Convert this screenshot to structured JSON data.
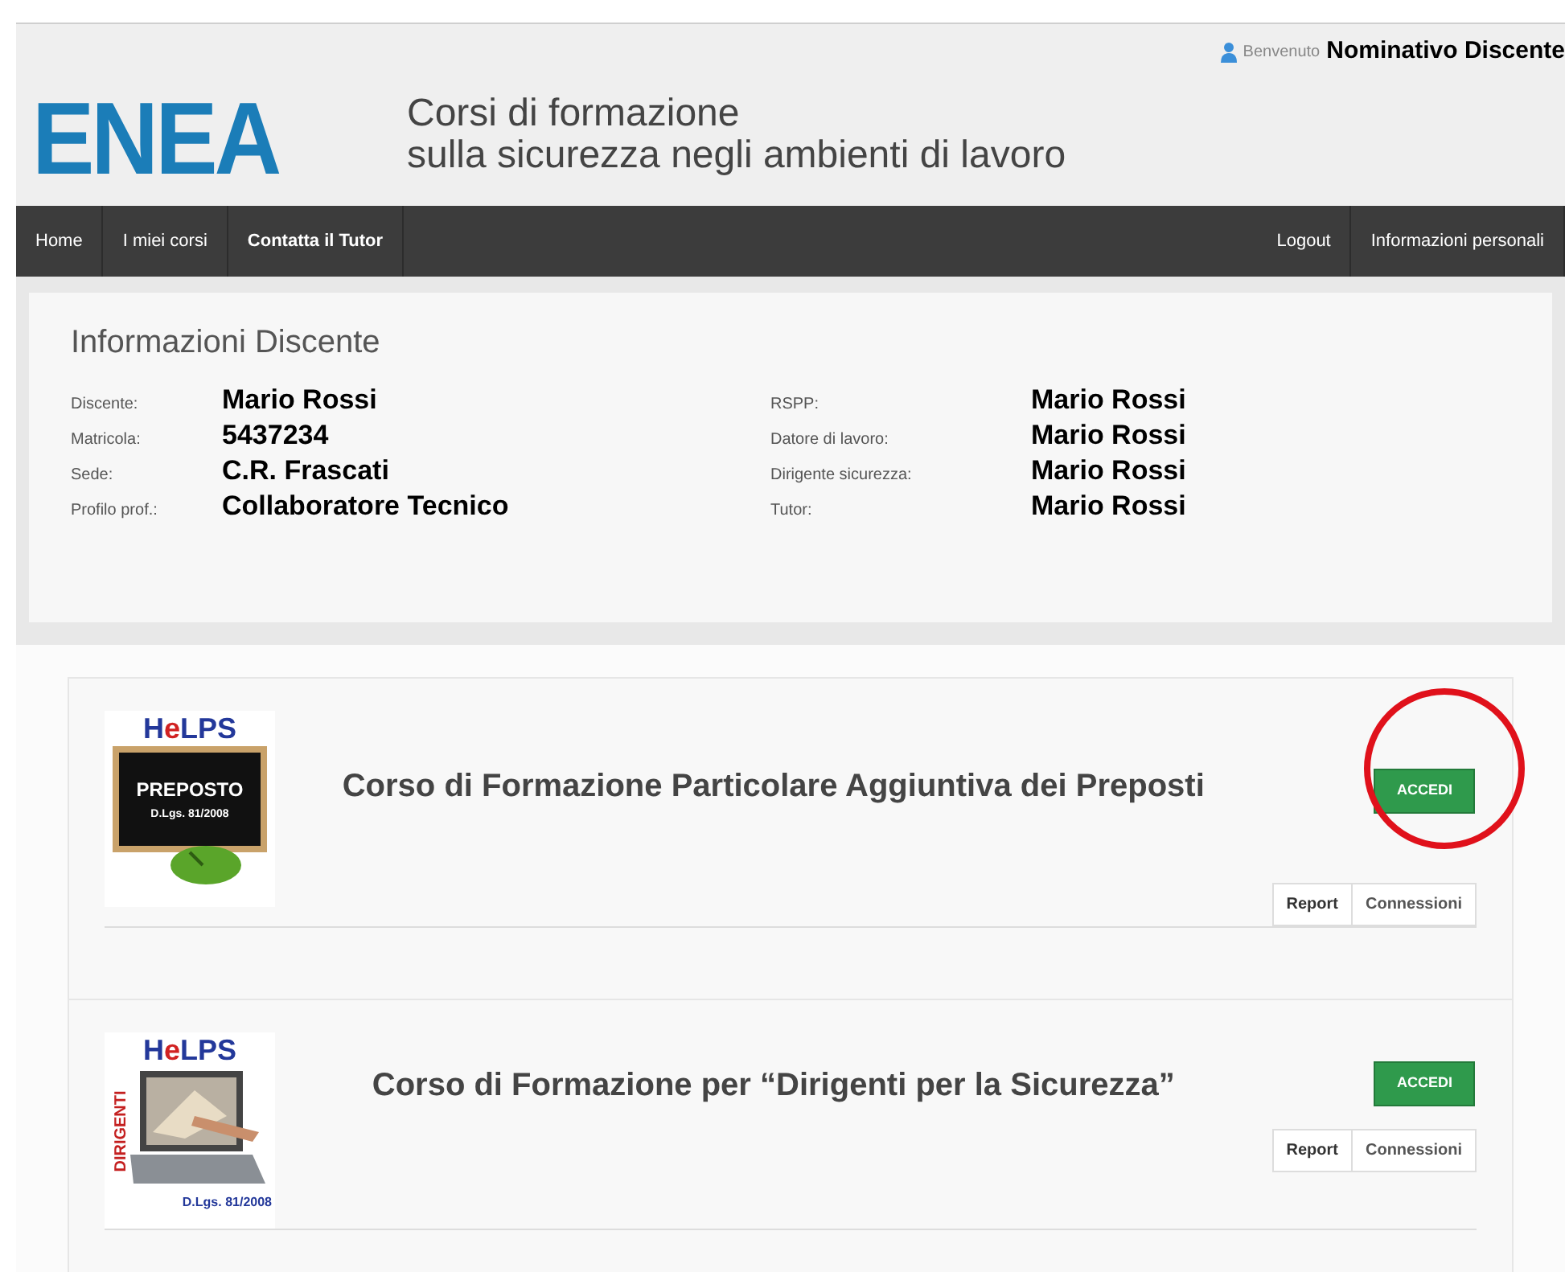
{
  "header": {
    "logo": "ENEA",
    "title_line_1": "Corsi di formazione",
    "title_line_2": "sulla sicurezza negli ambienti di lavoro",
    "welcome": "Benvenuto",
    "user_name": "Nominativo Discente"
  },
  "nav": {
    "left": [
      "Home",
      "I miei corsi",
      "Contatta il Tutor"
    ],
    "right": [
      "Logout",
      "Informazioni personali"
    ]
  },
  "info": {
    "title": "Informazioni Discente",
    "left": [
      {
        "label": "Discente:",
        "value": "Mario Rossi"
      },
      {
        "label": "Matricola:",
        "value": "5437234"
      },
      {
        "label": "Sede:",
        "value": "C.R. Frascati"
      },
      {
        "label": "Profilo prof.:",
        "value": "Collaboratore Tecnico"
      }
    ],
    "right": [
      {
        "label": "RSPP:",
        "value": "Mario Rossi"
      },
      {
        "label": "Datore di lavoro:",
        "value": "Mario Rossi"
      },
      {
        "label": "Dirigente sicurezza:",
        "value": "Mario Rossi"
      },
      {
        "label": "Tutor:",
        "value": "Mario Rossi"
      }
    ]
  },
  "courses": [
    {
      "kind": "preposto",
      "thumb_brand": "HeLPS",
      "thumb_label": "PREPOSTO",
      "thumb_law": "D.Lgs. 81/2008",
      "title": "Corso di Formazione Particolare Aggiuntiva dei Preposti",
      "access": "ACCEDI",
      "report": "Report",
      "connections": "Connessioni",
      "highlighted": true
    },
    {
      "kind": "dirigenti",
      "thumb_brand": "HeLPS",
      "thumb_label": "DIRIGENTI",
      "thumb_law": "D.Lgs. 81/2008",
      "title": "Corso di Formazione per “Dirigenti per la Sicurezza”",
      "access": "ACCEDI",
      "report": "Report",
      "connections": "Connessioni",
      "highlighted": false
    }
  ]
}
